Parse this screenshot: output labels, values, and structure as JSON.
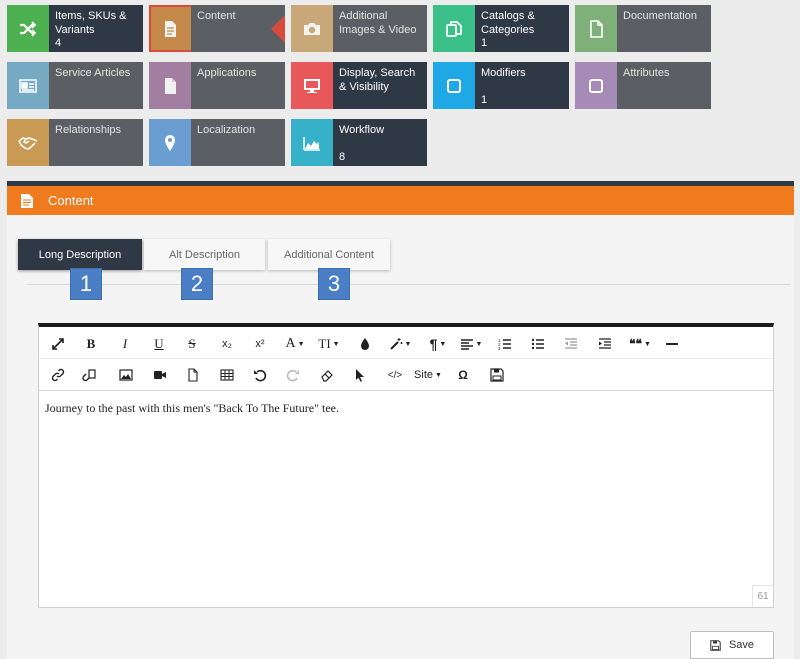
{
  "tiles": [
    {
      "label": "Items, SKUs & Variants",
      "count": "4",
      "icon": "shuffle-icon",
      "color": "#4caf50"
    },
    {
      "label": "Content",
      "count": "",
      "icon": "document-icon",
      "color": "#c4894a"
    },
    {
      "label": "Additional Images & Video",
      "count": "",
      "icon": "camera-icon",
      "color": "#c8a878"
    },
    {
      "label": "Catalogs & Categories",
      "count": "1",
      "icon": "copy-icon",
      "color": "#3cc08a"
    },
    {
      "label": "Documentation",
      "count": "",
      "icon": "file-icon",
      "color": "#7fb07a"
    },
    {
      "label": "Service Articles",
      "count": "",
      "icon": "id-card-icon",
      "color": "#76a9c4"
    },
    {
      "label": "Applications",
      "count": "",
      "icon": "document-icon",
      "color": "#a27fa0"
    },
    {
      "label": "Display, Search & Visibility",
      "count": "",
      "icon": "monitor-icon",
      "color": "#e8585a"
    },
    {
      "label": "Modifiers",
      "count": "1",
      "icon": "checkbox-icon",
      "color": "#1fa8e6"
    },
    {
      "label": "Attributes",
      "count": "",
      "icon": "checkbox-icon",
      "color": "#a58bb5"
    },
    {
      "label": "Relationships",
      "count": "",
      "icon": "handshake-icon",
      "color": "#c99a54"
    },
    {
      "label": "Localization",
      "count": "",
      "icon": "map-pin-icon",
      "color": "#6a9ed1"
    },
    {
      "label": "Workflow",
      "count": "8",
      "icon": "area-chart-icon",
      "color": "#37b0c9"
    }
  ],
  "panel": {
    "title": "Content",
    "header_color": "#f07b1f"
  },
  "tabs": [
    {
      "label": "Long Description",
      "badge": "1"
    },
    {
      "label": "Alt Description",
      "badge": "2"
    },
    {
      "label": "Additional Content",
      "badge": "3"
    }
  ],
  "toolbar": {
    "row1": [
      "fullscreen",
      "bold",
      "italic",
      "underline",
      "strikethrough",
      "subscript",
      "superscript",
      "font-size",
      "text-height",
      "color",
      "magic",
      "paragraph",
      "align",
      "ordered-list",
      "unordered-list",
      "outdent",
      "indent",
      "quote",
      "horizontal-rule"
    ],
    "row2": [
      "link",
      "unlink",
      "image",
      "video",
      "file",
      "table",
      "undo",
      "redo",
      "eraser",
      "select",
      "code-view",
      "site",
      "special-char",
      "save"
    ],
    "labels": {
      "bold": "B",
      "italic": "I",
      "underline": "U",
      "strike": "S",
      "subscript": "x₂",
      "superscript": "x²",
      "font": "A",
      "text_height": "TI",
      "pilcrow": "¶",
      "quote": "❝❝",
      "code": "</>",
      "site": "Site",
      "omega": "Ω"
    }
  },
  "editor": {
    "content": "Journey to the past with this men's \"Back To The Future\" tee.",
    "char_count": "61"
  },
  "save_button": {
    "label": "Save"
  }
}
